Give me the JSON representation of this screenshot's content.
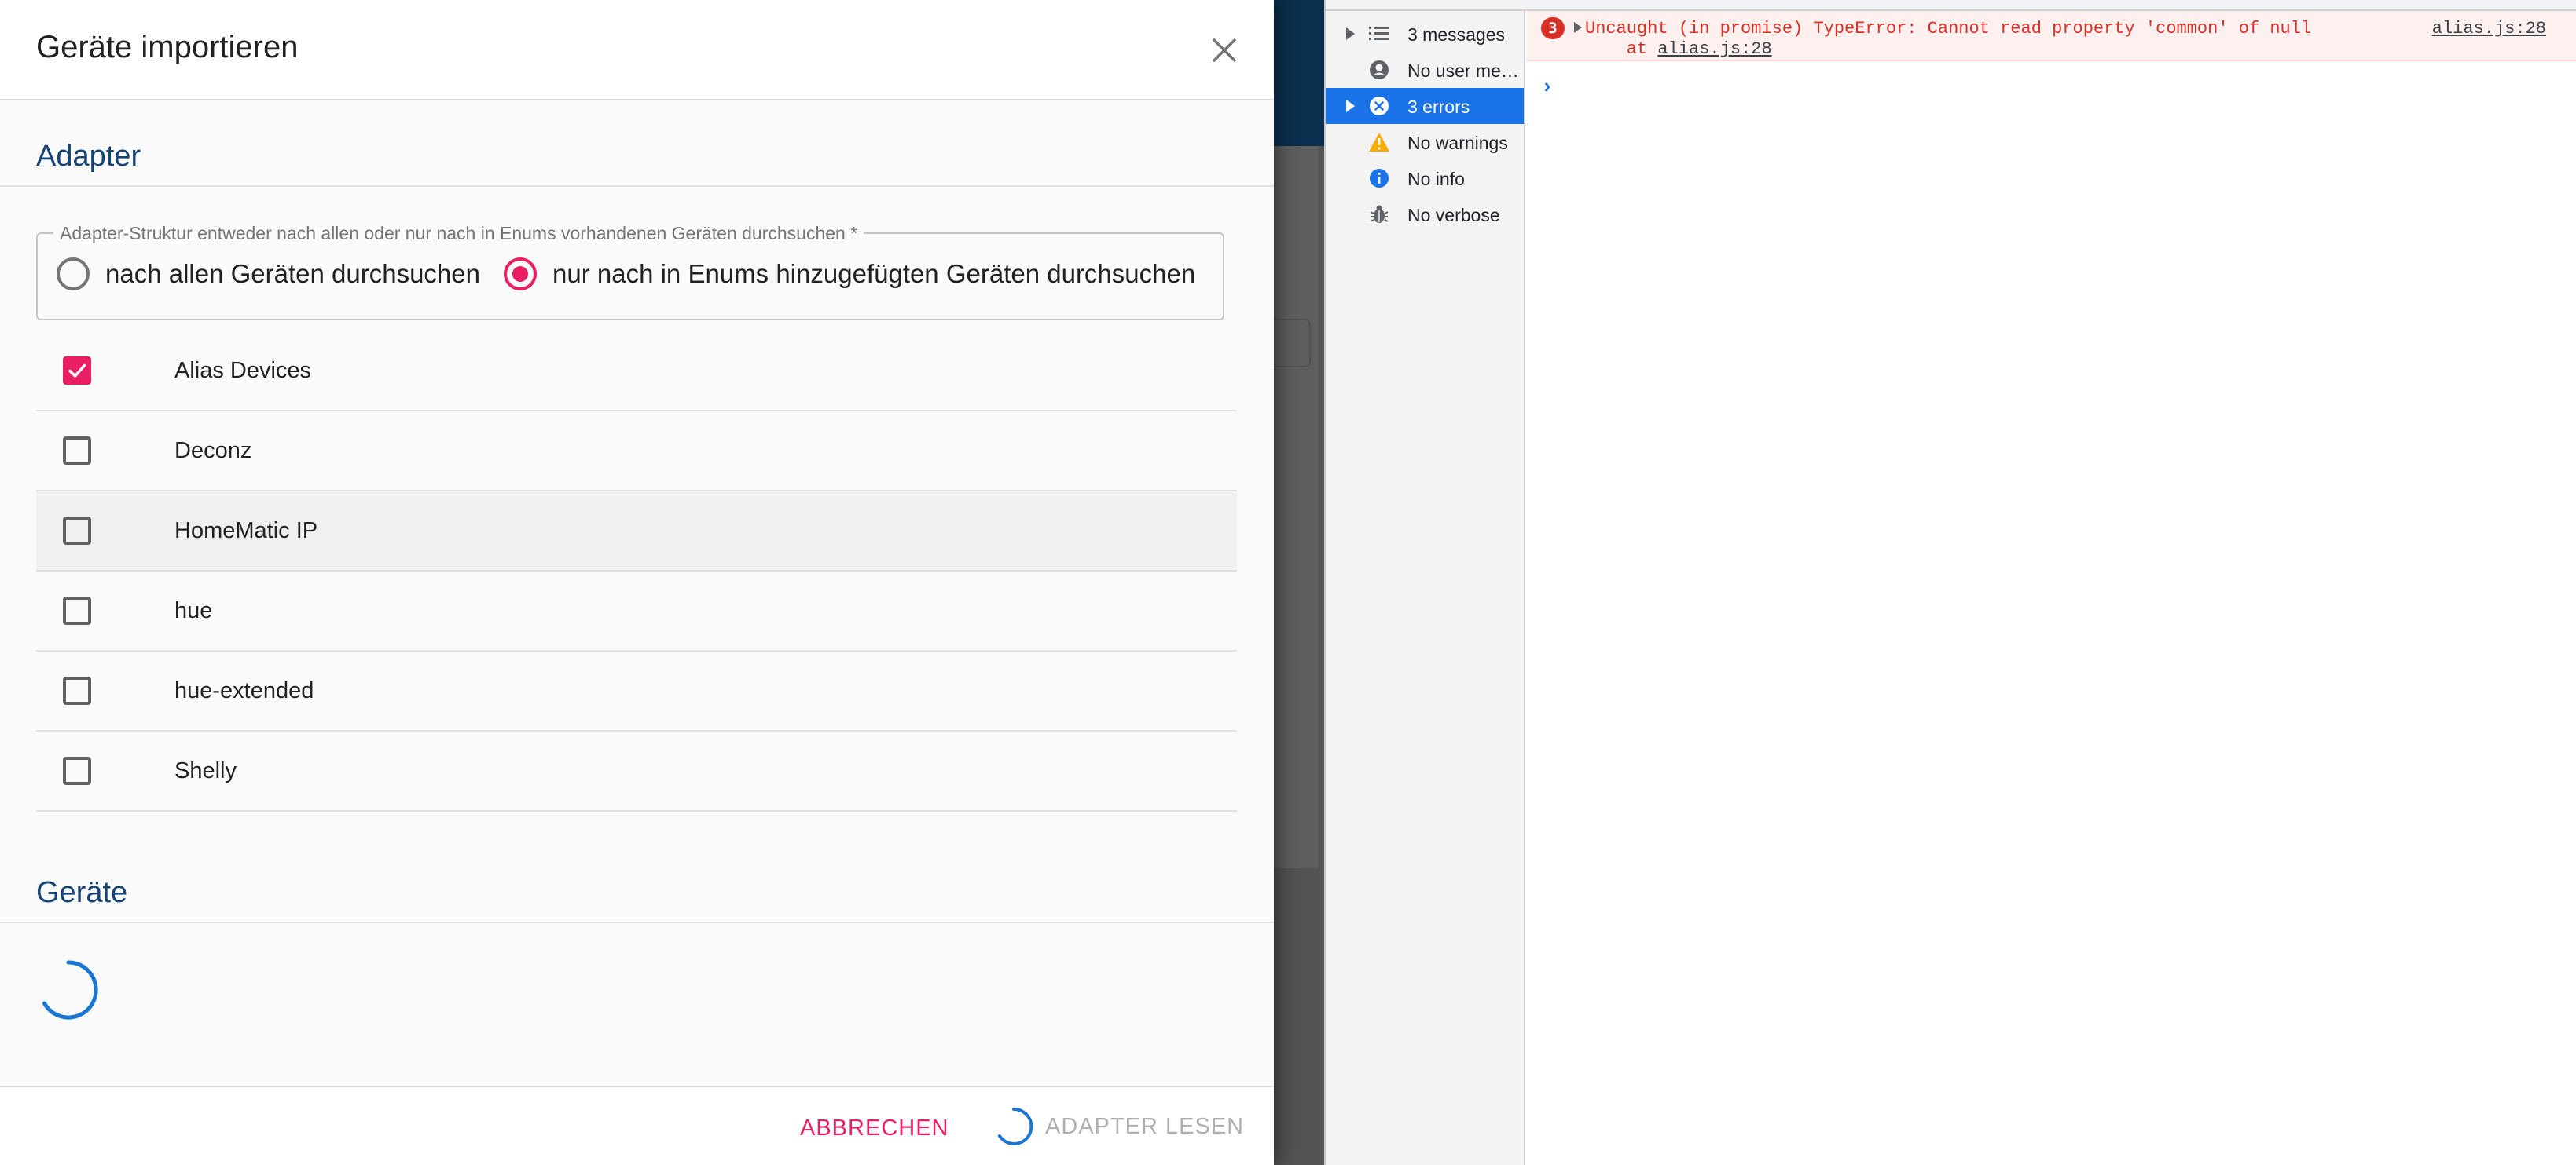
{
  "dialog": {
    "title": "Geräte importieren",
    "adapter_section": "Adapter",
    "devices_section": "Geräte",
    "search_mode": {
      "legend": "Adapter-Struktur entweder nach allen oder nur nach in Enums vorhandenen Geräten durchsuchen *",
      "options": [
        {
          "label": "nach allen Geräten durchsuchen",
          "checked": false
        },
        {
          "label": "nur nach in Enums hinzugefügten Geräten durchsuchen",
          "checked": true
        }
      ]
    },
    "adapters": [
      {
        "name": "Alias Devices",
        "checked": true
      },
      {
        "name": "Deconz",
        "checked": false
      },
      {
        "name": "HomeMatic IP",
        "checked": false
      },
      {
        "name": "hue",
        "checked": false
      },
      {
        "name": "hue-extended",
        "checked": false
      },
      {
        "name": "Shelly",
        "checked": false
      }
    ],
    "buttons": {
      "cancel": "ABBRECHEN",
      "read_adapter": "ADAPTER LESEN"
    }
  },
  "devtools": {
    "sidebar": [
      {
        "label": "3 messages",
        "icon": "list-icon"
      },
      {
        "label": "No user messages",
        "icon": "user-icon"
      },
      {
        "label": "3 errors",
        "icon": "error-icon"
      },
      {
        "label": "No warnings",
        "icon": "warning-icon"
      },
      {
        "label": "No info",
        "icon": "info-icon"
      },
      {
        "label": "No verbose",
        "icon": "bug-icon"
      }
    ],
    "error": {
      "count": "3",
      "message": "Uncaught (in promise) TypeError: Cannot read property 'common' of null",
      "stack_prefix": "    at ",
      "stack_link": "alias.js:28",
      "source": "alias.js:28"
    },
    "prompt": "›"
  },
  "colors": {
    "accent": "#e91e63",
    "section_title": "#164477",
    "spinner": "#1976d2",
    "error": "#d93025",
    "selection": "#1a73e8"
  }
}
